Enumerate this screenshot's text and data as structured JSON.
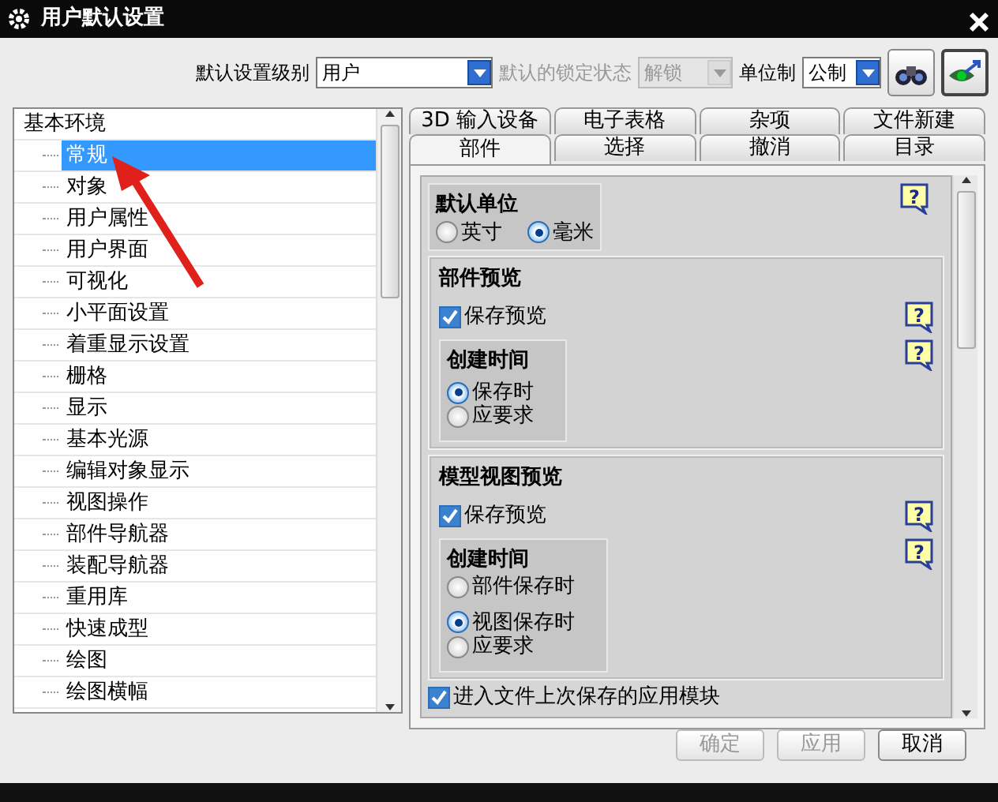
{
  "window": {
    "title": "用户默认设置"
  },
  "toolbar": {
    "level_label": "默认设置级别",
    "level_value": "用户",
    "lock_label": "默认的锁定状态",
    "lock_value": "解锁",
    "lock_disabled": true,
    "unit_label": "单位制",
    "unit_value": "公制"
  },
  "tree": {
    "root": "基本环境",
    "children": [
      {
        "label": "常规",
        "selected": true
      },
      {
        "label": "对象",
        "selected": false
      },
      {
        "label": "用户属性",
        "selected": false
      },
      {
        "label": "用户界面",
        "selected": false
      },
      {
        "label": "可视化",
        "selected": false
      },
      {
        "label": "小平面设置",
        "selected": false
      },
      {
        "label": "着重显示设置",
        "selected": false
      },
      {
        "label": "栅格",
        "selected": false
      },
      {
        "label": "显示",
        "selected": false
      },
      {
        "label": "基本光源",
        "selected": false
      },
      {
        "label": "编辑对象显示",
        "selected": false
      },
      {
        "label": "视图操作",
        "selected": false
      },
      {
        "label": "部件导航器",
        "selected": false
      },
      {
        "label": "装配导航器",
        "selected": false
      },
      {
        "label": "重用库",
        "selected": false
      },
      {
        "label": "快速成型",
        "selected": false
      },
      {
        "label": "绘图",
        "selected": false
      },
      {
        "label": "绘图横幅",
        "selected": false
      }
    ]
  },
  "tabs": [
    [
      {
        "label": "3D 输入设备",
        "selected": false
      },
      {
        "label": "电子表格",
        "selected": false
      },
      {
        "label": "杂项",
        "selected": false
      },
      {
        "label": "文件新建",
        "selected": false
      }
    ],
    [
      {
        "label": "部件",
        "selected": true
      },
      {
        "label": "选择",
        "selected": false
      },
      {
        "label": "撤消",
        "selected": false
      },
      {
        "label": "目录",
        "selected": false
      }
    ]
  ],
  "default_units": {
    "title": "默认单位",
    "help": "?",
    "options": [
      {
        "label": "英寸",
        "selected": false
      },
      {
        "label": "毫米",
        "selected": true
      }
    ]
  },
  "sections": [
    {
      "title": "部件预览",
      "help": [
        "?",
        "?"
      ],
      "checkbox": {
        "label": "保存预览",
        "checked": true
      },
      "group_title": "创建时间",
      "options": [
        {
          "label": "保存时",
          "selected": true
        },
        {
          "label": "应要求",
          "selected": false
        }
      ]
    },
    {
      "title": "模型视图预览",
      "help": [
        "?",
        "?"
      ],
      "checkbox": {
        "label": "保存预览",
        "checked": true
      },
      "group_title": "创建时间",
      "options": [
        {
          "label": "部件保存时",
          "selected": false
        },
        {
          "label": "视图保存时",
          "selected": true
        },
        {
          "label": "应要求",
          "selected": false
        }
      ]
    }
  ],
  "last_option": {
    "label": "进入文件上次保存的应用模块",
    "checked": true
  },
  "buttons": [
    {
      "label": "确定",
      "disabled": true
    },
    {
      "label": "应用",
      "disabled": true
    },
    {
      "label": "取消",
      "disabled": false
    }
  ]
}
